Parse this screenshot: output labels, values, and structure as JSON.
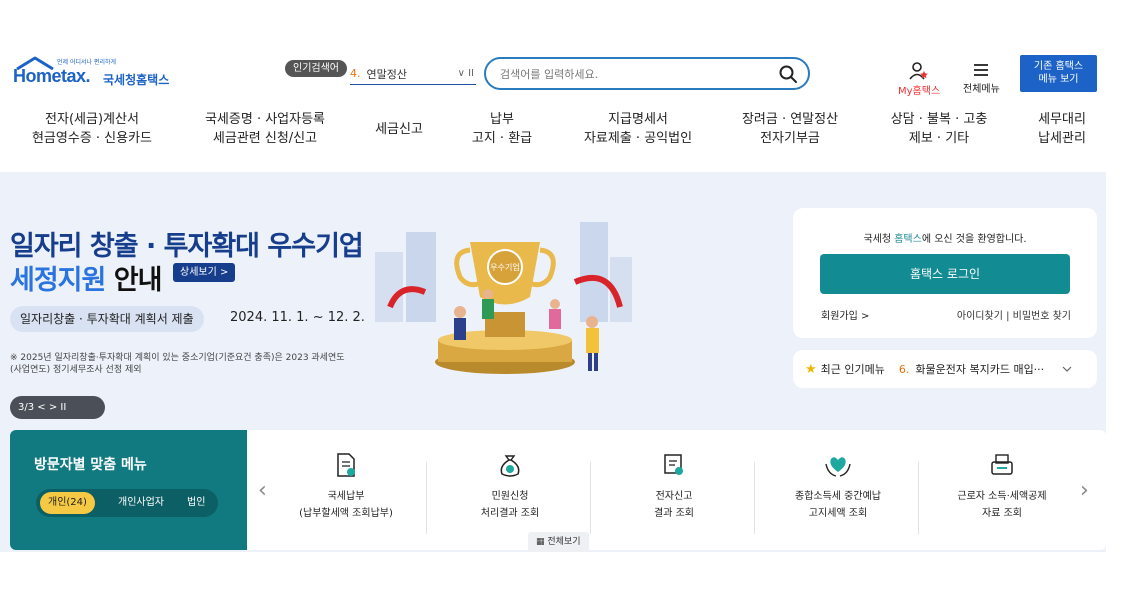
{
  "header": {
    "logo": {
      "word": "Hometax.",
      "sub": "국세청홈택스",
      "tag": "언제 어디서나 편리하게"
    },
    "popular": {
      "badge": "인기검색어",
      "rank": "4.",
      "text": "연말정산",
      "controls": "∨ II"
    },
    "search": {
      "placeholder": "검색어를 입력하세요."
    },
    "my_hometax": "My홈택스",
    "all_menu": "전체메뉴",
    "old_button": [
      "기존 홈택스",
      "메뉴 보기"
    ]
  },
  "gnb": [
    {
      "line1": "전자(세금)계산서",
      "line2": "현금영수증 · 신용카드"
    },
    {
      "line1": "국세증명 · 사업자등록",
      "line2": "세금관련 신청/신고"
    },
    {
      "line1": "세금신고",
      "line2": ""
    },
    {
      "line1": "납부",
      "line2": "고지 · 환급"
    },
    {
      "line1": "지급명세서",
      "line2": "자료제출 · 공익법인"
    },
    {
      "line1": "장려금 · 연말정산",
      "line2": "전자기부금"
    },
    {
      "line1": "상담 · 불복 · 고충",
      "line2": "제보 · 기타"
    },
    {
      "line1": "세무대리",
      "line2": "납세관리"
    }
  ],
  "hero": {
    "title1": "일자리 창출 · 투자확대 우수기업",
    "title2_blue": "세정지원",
    "title2_dark": "안내",
    "detail_button": "상세보기 >",
    "pill": "일자리창출 · 투자확대 계획서 제출",
    "date": "2024. 11. 1. ~ 12. 2.",
    "note": "※ 2025년 일자리창출·투자확대 계획이 있는 중소기업(기준요건 충족)은 2023 과세연도(사업연도) 정기세무조사 선정 제외",
    "slide_control": "3/3  <   >   II",
    "trophy_text": "우수기업"
  },
  "login": {
    "welcome_pre": "국세청 ",
    "welcome_hl": "홈택스",
    "welcome_post": "에 오신 것을 환영합니다.",
    "button": "홈택스 로그인",
    "join": "회원가입 >",
    "find": "아이디찾기  |  비밀번호 찾기"
  },
  "recent": {
    "label": "최근 인기메뉴",
    "rank": "6.",
    "text": "화물운전자 복지카드 매입···"
  },
  "quick": {
    "title": "방문자별 맞춤 메뉴",
    "tabs": [
      "개인(24)",
      "개인사업자",
      "법인"
    ],
    "items": [
      {
        "line1": "국세납부",
        "line2": "(납부할세액 조회납부)",
        "icon": "tax-payment-icon"
      },
      {
        "line1": "민원신청",
        "line2": "처리결과 조회",
        "icon": "money-bag-icon"
      },
      {
        "line1": "전자신고",
        "line2": "결과 조회",
        "icon": "e-filing-icon"
      },
      {
        "line1": "종합소득세 중간예납",
        "line2": "고지세액 조회",
        "icon": "hands-heart-icon"
      },
      {
        "line1": "근로자 소득·세액공제",
        "line2": "자료 조회",
        "icon": "document-print-icon"
      }
    ],
    "view_all": "전체보기"
  },
  "colors": {
    "brand": "#1d63c7",
    "teal": "#117a80",
    "login": "#138b93",
    "accent": "#e8730c",
    "tab_active": "#f6c945"
  }
}
